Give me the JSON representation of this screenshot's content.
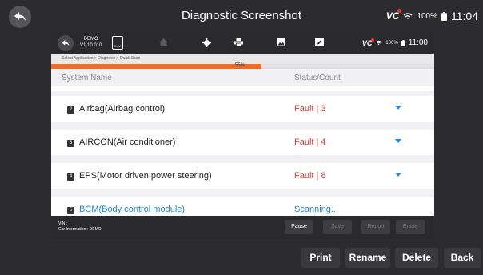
{
  "window": {
    "title": "Diagnostic Screenshot",
    "vci": "VC",
    "battery": "100%",
    "time": "11:04"
  },
  "inner": {
    "demo_line1": "DEMO",
    "demo_line2": "V1.10.010",
    "battery_label": "0.0V",
    "vci": "VC",
    "battery": "100%",
    "time": "11:00",
    "breadcrumb": "Select Application > Diagnosis >  Quick Scan",
    "progress": {
      "percent": 55,
      "label": "55%"
    },
    "columns": {
      "name": "System Name",
      "status": "Status/Count"
    },
    "systems": [
      {
        "num": "2",
        "name": "Airbag(Airbag control)",
        "status": "Fault | 3",
        "expandable": true,
        "scanning": false
      },
      {
        "num": "3",
        "name": "AIRCON(Air conditioner)",
        "status": "Fault | 4",
        "expandable": true,
        "scanning": false
      },
      {
        "num": "4",
        "name": "EPS(Motor driven power steering)",
        "status": "Fault | 8",
        "expandable": true,
        "scanning": false
      },
      {
        "num": "5",
        "name": "BCM(Body control module)",
        "status": "Scanning...",
        "expandable": false,
        "scanning": true
      }
    ],
    "vin_label": "VIN :",
    "car_info": "Car Information : DEMO",
    "buttons": {
      "pause": "Pause",
      "save": "Save",
      "report": "Report",
      "erase": "Erase"
    }
  },
  "bottom_buttons": {
    "print": "Print",
    "rename": "Rename",
    "delete": "Delete",
    "back": "Back"
  },
  "colors": {
    "fault": "#e53935",
    "scanning": "#1e88e5",
    "progress": "#f36c21",
    "bar": "#2c2c2e"
  }
}
